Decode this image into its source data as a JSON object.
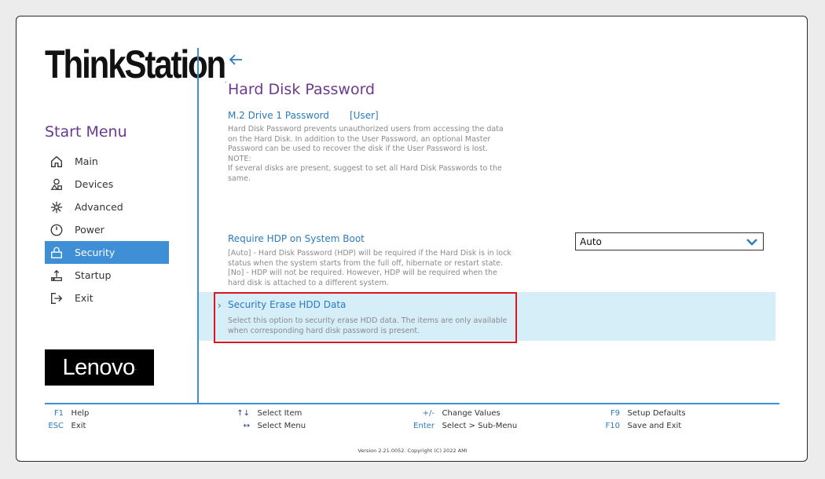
{
  "sidebar": {
    "brand": "ThinkStation",
    "brand_tm": ".",
    "title": "Start Menu",
    "items": [
      {
        "label": "Main"
      },
      {
        "label": "Devices"
      },
      {
        "label": "Advanced"
      },
      {
        "label": "Power"
      },
      {
        "label": "Security"
      },
      {
        "label": "Startup"
      },
      {
        "label": "Exit"
      }
    ],
    "vendor_logo": "Lenovo",
    "vendor_logo_mark": "."
  },
  "main": {
    "title": "Hard Disk Password",
    "m2": {
      "label": "M.2 Drive 1 Password",
      "value": "[User]",
      "desc": [
        "Hard Disk Password prevents unauthorized users from accessing the data",
        "on the Hard Disk. In addition to the User Password, an optional Master",
        "Password can be used to recover the disk if the User Password is lost.",
        "NOTE:",
        "If several disks are present, suggest to set all Hard Disk Passwords to the",
        "same."
      ]
    },
    "hdp_boot": {
      "label": "Require HDP on System Boot",
      "selected": "Auto",
      "desc": [
        "[Auto] - Hard Disk Password (HDP) will be required if the Hard Disk is in lock",
        "status when the system starts from the full off, hibernate or restart state.",
        "[No] - HDP will not be required. However, HDP will be required when the",
        "hard disk is attached to a different system."
      ]
    },
    "erase": {
      "label": "Security Erase HDD Data",
      "desc": [
        "Select this option to security erase HDD data. The items are only available",
        "when corresponding hard disk password is present."
      ]
    }
  },
  "footer": {
    "keys": [
      {
        "key": "F1",
        "action": "Help"
      },
      {
        "key": "ESC",
        "action": "Exit"
      },
      {
        "key": "↑↓",
        "action": "Select Item"
      },
      {
        "key": "↔",
        "action": "Select Menu"
      },
      {
        "key": "+/-",
        "action": "Change Values"
      },
      {
        "key": "Enter",
        "action": "Select > Sub-Menu"
      },
      {
        "key": "F9",
        "action": "Setup Defaults"
      },
      {
        "key": "F10",
        "action": "Save and Exit"
      }
    ],
    "version": "Version 2.21.0052. Copyright (C) 2022 AMI"
  },
  "colors": {
    "accent": "#3f8fd6",
    "title": "#6b3a8e",
    "link": "#2b7bbf",
    "highlight": "#d5eef8",
    "annotation": "#e0141e"
  }
}
